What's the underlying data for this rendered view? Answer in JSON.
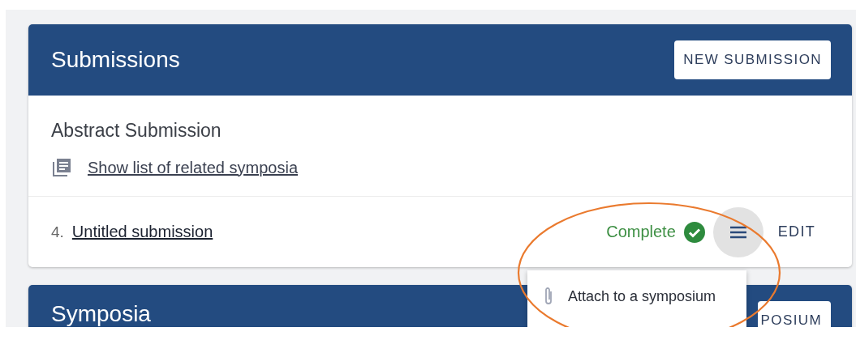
{
  "submissions": {
    "title": "Submissions",
    "new_button": "NEW SUBMISSION",
    "form_title": "Abstract Submission",
    "related_link": "Show list of related symposia",
    "items": [
      {
        "number": "4.",
        "title": "Untitled submission",
        "status": "Complete",
        "complete": true,
        "menu_open": true,
        "edit": "EDIT"
      }
    ]
  },
  "item_menu": {
    "items": [
      "Attach to a symposium"
    ]
  },
  "symposia": {
    "title": "Symposia",
    "button": "POSIUM"
  }
}
